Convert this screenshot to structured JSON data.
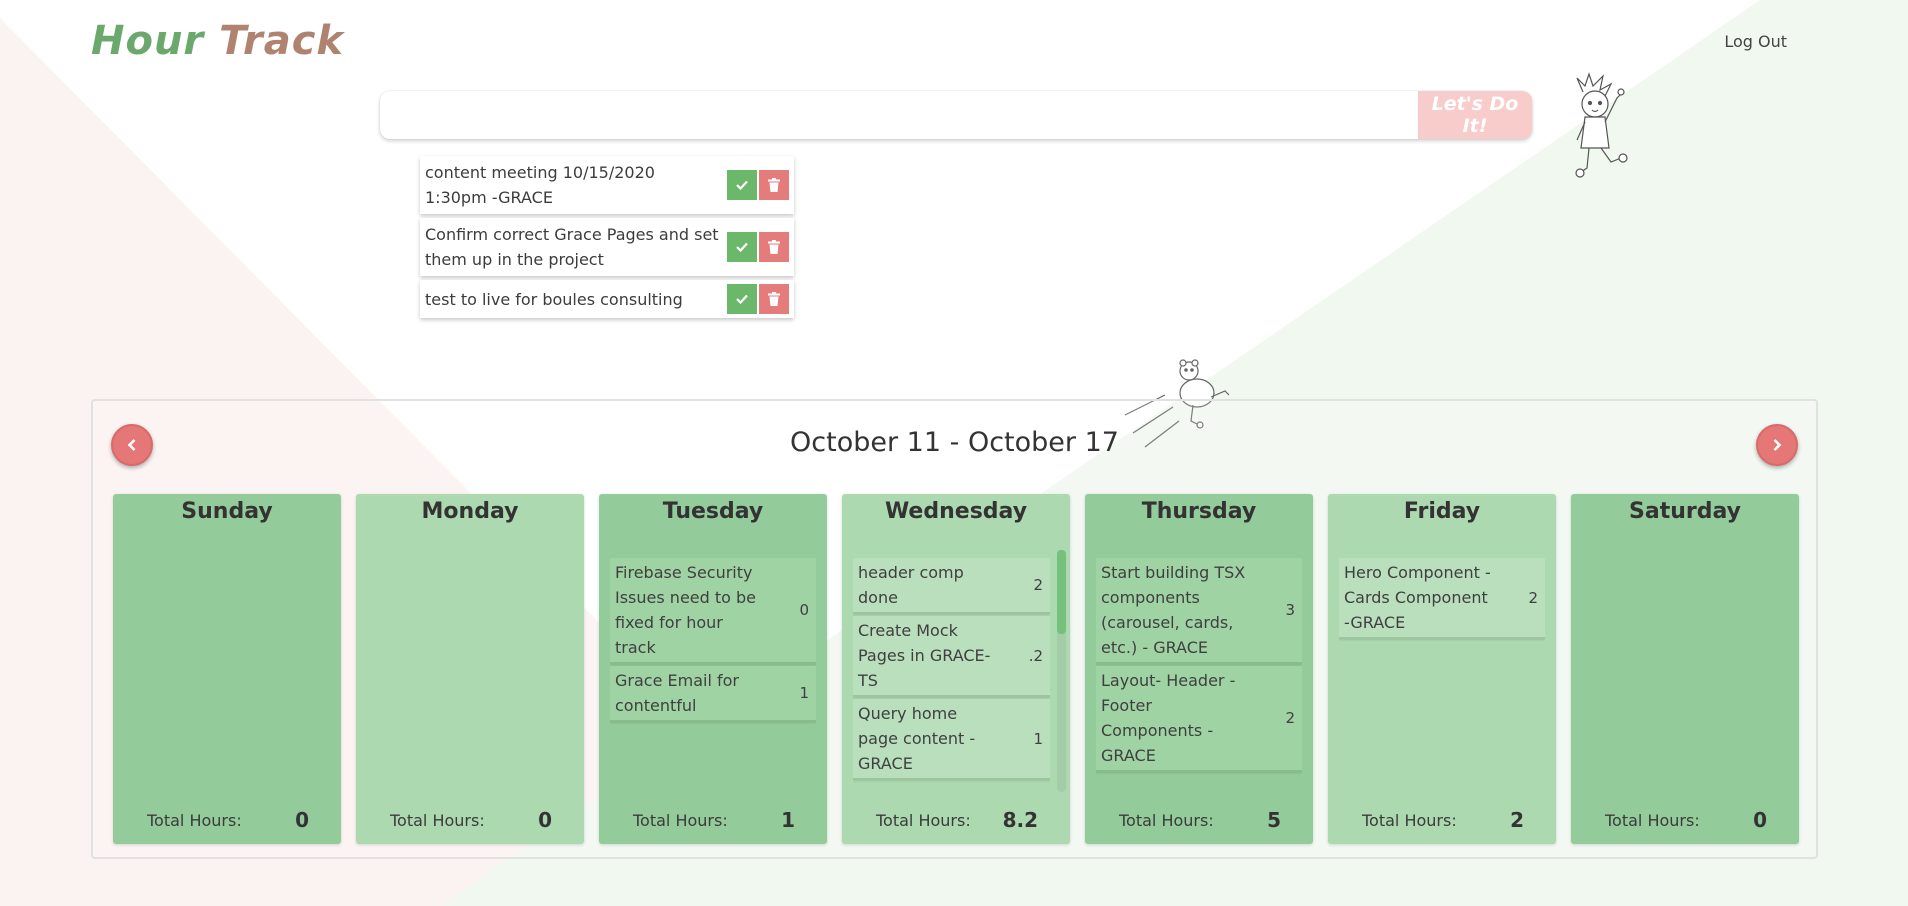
{
  "app": {
    "logo_word1": "Hour",
    "logo_word2": "Track",
    "logout_label": "Log Out"
  },
  "task_form": {
    "input_value": "",
    "input_placeholder": "",
    "submit_label": "Let's Do It!"
  },
  "todos": [
    {
      "text": "content meeting 10/15/2020 1:30pm -GRACE"
    },
    {
      "text": "Confirm correct Grace Pages and set them up in the project"
    },
    {
      "text": "test to live for boules consulting"
    }
  ],
  "calendar": {
    "week_title": "October 11 - October 17",
    "total_label": "Total Hours:",
    "days": [
      {
        "name": "Sunday",
        "total": "0",
        "entries": []
      },
      {
        "name": "Monday",
        "total": "0",
        "entries": []
      },
      {
        "name": "Tuesday",
        "total": "1",
        "entries": [
          {
            "task": "Firebase Security Issues need to be fixed for hour track",
            "hours": "0"
          },
          {
            "task": "Grace Email for contentful",
            "hours": "1"
          }
        ]
      },
      {
        "name": "Wednesday",
        "total": "8.2",
        "entries": [
          {
            "task": "header comp done",
            "hours": "2"
          },
          {
            "task": "Create Mock Pages in GRACE-TS",
            "hours": ".2"
          },
          {
            "task": "Query home page content - GRACE",
            "hours": "1"
          }
        ]
      },
      {
        "name": "Thursday",
        "total": "5",
        "entries": [
          {
            "task": "Start building TSX components (carousel, cards, etc.) - GRACE",
            "hours": "3"
          },
          {
            "task": "Layout- Header - Footer Components - GRACE",
            "hours": "2"
          }
        ]
      },
      {
        "name": "Friday",
        "total": "2",
        "entries": [
          {
            "task": "Hero Component - Cards Component -GRACE",
            "hours": "2"
          }
        ]
      },
      {
        "name": "Saturday",
        "total": "0",
        "entries": []
      }
    ]
  },
  "colors": {
    "accent_green": "#6cb86a",
    "accent_red": "#e47c7c",
    "day_dark": "#93cc9a",
    "day_light": "#acd9b0",
    "submit_bg": "#f7cccb"
  },
  "icons": {
    "check": "check-icon",
    "trash": "trash-icon",
    "prev": "chevron-left-icon",
    "next": "chevron-right-icon"
  }
}
